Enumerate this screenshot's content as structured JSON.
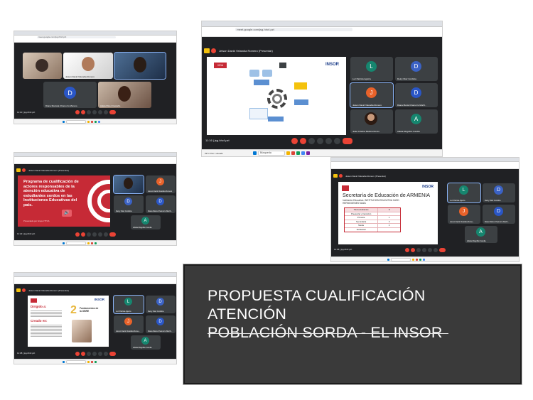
{
  "title_card": {
    "line1": "PROPUESTA CUALIFICACIÓN ATENCIÓN",
    "line2": "POBLACIÓN SORDA -  EL INSOR"
  },
  "colors": {
    "meet_bg": "#202124",
    "tile_bg": "#3c4043",
    "end_call": "#ea4335",
    "slide_red": "#c62a36",
    "title_box": "#3a3a3a"
  },
  "shot1": {
    "url": "meet.google.com/jsg-hhcf-pzt",
    "meet_code": "11:10 | jsg-hhcf-pzt",
    "tiles": [
      {
        "name": "",
        "kind": "video"
      },
      {
        "name": "Jeison David Velandia Romero",
        "kind": "video"
      },
      {
        "name": "",
        "kind": "video"
      },
      {
        "name": "Diana Marcela Chamorro Moreno",
        "initial": "D",
        "kind": "avatar",
        "color": "#2a56c6"
      },
      {
        "name": "Adela Pérez Castaño",
        "kind": "video"
      }
    ]
  },
  "shot2": {
    "url": "meet.google.com/jsg-hhcf-pzt",
    "presenting": "Jeison David Velandia Romero (Presentar)",
    "meet_code": "11:16 | jsg-hhcf-pzt",
    "slide_logo": "INSOR",
    "slide_brand": "VIDA",
    "tiles": [
      {
        "name": "Luz Patricia Aguirre",
        "initial": "L",
        "color": "#16866f"
      },
      {
        "name": "Deiny Diaz Cordoba",
        "initial": "D",
        "color": "#3b62c4"
      },
      {
        "name": "Jeison David Velandia Romero",
        "initial": "J",
        "color": "#e8622a"
      },
      {
        "name": "Diana María Chamorro Morill...",
        "initial": "D",
        "color": "#2a56c6"
      },
      {
        "name": "Juliet Cristina Medina Rozzo",
        "kind": "photo"
      },
      {
        "name": "Adiela Mogollón Candia",
        "initial": "A",
        "color": "#16866f"
      }
    ],
    "taskbar_search": "Búsqueda",
    "weather": "29°C Parc. soleado"
  },
  "shot3": {
    "presenting": "Jeison David Velandia Romero (Presentar)",
    "meet_code": "11:22 | jsg-hhcf-pzt",
    "slide_text": "Programa de cualificación de actores responsables de la atención educativa de estudiantes sordos en  las Instituciones Educativas del país.",
    "slide_footer": "Presentado por Grupo ITTCA",
    "tiles": [
      {
        "name": "",
        "kind": "video"
      },
      {
        "name": "Jeison David Velandia Romero",
        "initial": "J",
        "color": "#e8622a"
      },
      {
        "name": "Deiny Diaz Cordoba",
        "initial": "D",
        "color": "#3b62c4"
      },
      {
        "name": "Diana María Chamorro Morill...",
        "initial": "D",
        "color": "#2a56c6"
      },
      {
        "name": "Adiela Mogollón Candia",
        "initial": "A",
        "color": "#16866f"
      }
    ]
  },
  "shot4": {
    "presenting": "Jeison David Velandia Romero (Presentar)",
    "meet_code": "11:36 | jsg-hhcf-pzt",
    "slide_title": "Secretaría de Educación de ARMENIA",
    "slide_sub": "Institución Educativa: INSTITUCION EDUCATIVA CASD",
    "slide_sub2": "HERMOGENES MAZA",
    "slide_logo": "INSOR",
    "table": [
      [
        "Total estudiantes",
        "8"
      ],
      [
        "Preescolar y transición",
        ""
      ],
      [
        "Primaria",
        "1"
      ],
      [
        "Secundaria",
        "3"
      ],
      [
        "Media",
        "4"
      ],
      [
        "Extraedad",
        ""
      ]
    ],
    "tiles": [
      {
        "name": "Luz Patricia Aguirre",
        "initial": "L",
        "color": "#16866f"
      },
      {
        "name": "Deiny Diaz Cordoba",
        "initial": "D",
        "color": "#3b62c4"
      },
      {
        "name": "Jeison David Velandia Rome...",
        "initial": "J",
        "color": "#e8622a"
      },
      {
        "name": "Diana María Chamorro Morill...",
        "initial": "D",
        "color": "#2a56c6"
      },
      {
        "name": "Adiela Mogollón Candia",
        "initial": "A",
        "color": "#16866f"
      }
    ]
  },
  "shot5": {
    "presenting": "Jeison David Velandia Romero (Presentar)",
    "meet_code": "11:38 | jsg-hhcf-pzt",
    "slide_heading1": "Dirigido a:",
    "slide_heading2": "Creado en:",
    "slide_number": "2",
    "slide_caption": "Fundamentos de la OBRE",
    "slide_logo": "INSOR",
    "tiles": [
      {
        "name": "Luz Patricia Aguirre",
        "initial": "L",
        "color": "#16866f"
      },
      {
        "name": "Deiny Diaz Cordoba",
        "initial": "D",
        "color": "#3b62c4"
      },
      {
        "name": "Jeison David Velandia Rome...",
        "initial": "J",
        "color": "#e8622a"
      },
      {
        "name": "Diana María Chamorro Morill...",
        "initial": "D",
        "color": "#2a56c6"
      },
      {
        "name": "Adiela Mogollón Candia",
        "initial": "A",
        "color": "#16866f"
      }
    ]
  }
}
